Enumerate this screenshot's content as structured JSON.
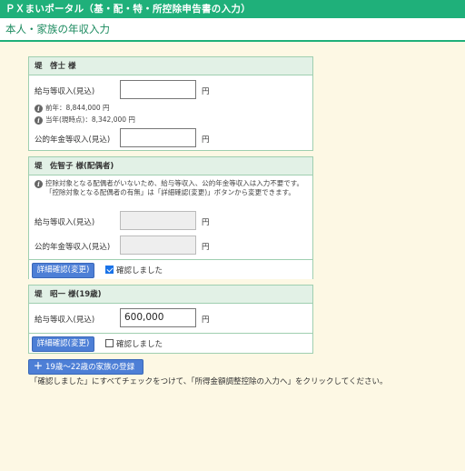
{
  "header": {
    "app_title": "ＰＸまいポータル（基・配・特・所控除申告書の入力）",
    "page_title": "本人・家族の年収入力"
  },
  "self": {
    "name": "堤　啓士 様",
    "salary_label": "給与等収入(見込)",
    "salary_value": "",
    "salary_unit": "円",
    "prev_year": "前年：8,844,000 円",
    "current_year": "当年(現時点)：8,342,000 円",
    "pension_label": "公的年金等収入(見込)",
    "pension_value": "",
    "pension_unit": "円"
  },
  "spouse": {
    "name": "堤　佐智子 様(配偶者)",
    "note": "控除対象となる配偶者がいないため、給与等収入、公的年金等収入は入力不要です。「控除対象となる配偶者の有無」は「詳細確認(変更)」ボタンから変更できます。",
    "salary_label": "給与等収入(見込)",
    "salary_value": "",
    "salary_unit": "円",
    "pension_label": "公的年金等収入(見込)",
    "pension_value": "",
    "pension_unit": "円",
    "detail_button": "詳細確認(変更)",
    "confirm_label": "確認しました",
    "confirm_checked": true
  },
  "child": {
    "name": "堤　昭一 様(19歳)",
    "salary_label": "給与等収入(見込)",
    "salary_value": "600,000",
    "salary_unit": "円",
    "detail_button": "詳細確認(変更)",
    "confirm_label": "確認しました",
    "confirm_checked": false
  },
  "add_family_button": "19歳〜22歳の家族の登録",
  "instruction": "「確認しました」にすべてチェックをつけて、「所得金額調整控除の入力へ」をクリックしてください。",
  "icons": {
    "info": "info-icon",
    "plus": "plus-icon",
    "checkbox": "checkbox-icon"
  },
  "colors": {
    "header_green": "#1fb07a",
    "card_head_bg": "#e2f1e6",
    "page_bg": "#fdf8e4",
    "button_blue": "#4d7fd6"
  }
}
